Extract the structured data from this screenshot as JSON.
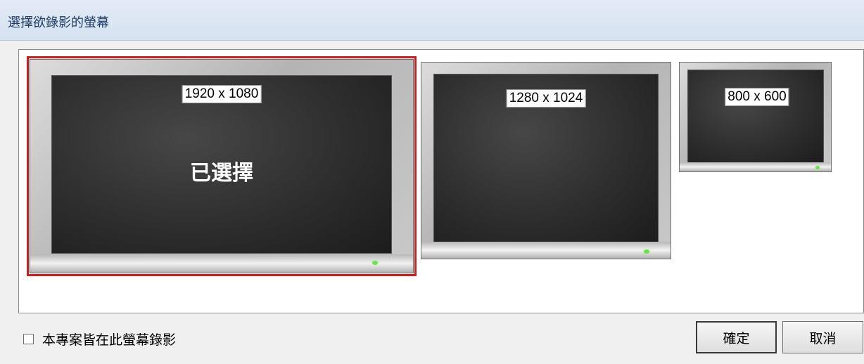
{
  "dialog": {
    "title": "選擇欲錄影的螢幕"
  },
  "monitors": [
    {
      "resolution": "1920 x 1080",
      "selected": true,
      "selected_label": "已選擇"
    },
    {
      "resolution": "1280 x 1024",
      "selected": false
    },
    {
      "resolution": "800 x 600",
      "selected": false
    }
  ],
  "footer": {
    "checkbox_label": "本專案皆在此螢幕錄影",
    "checkbox_checked": false,
    "ok_label": "確定",
    "cancel_label": "取消"
  },
  "colors": {
    "selection_border": "#d41a1a",
    "power_led": "#6fe050",
    "title_text": "#1e3b64"
  }
}
